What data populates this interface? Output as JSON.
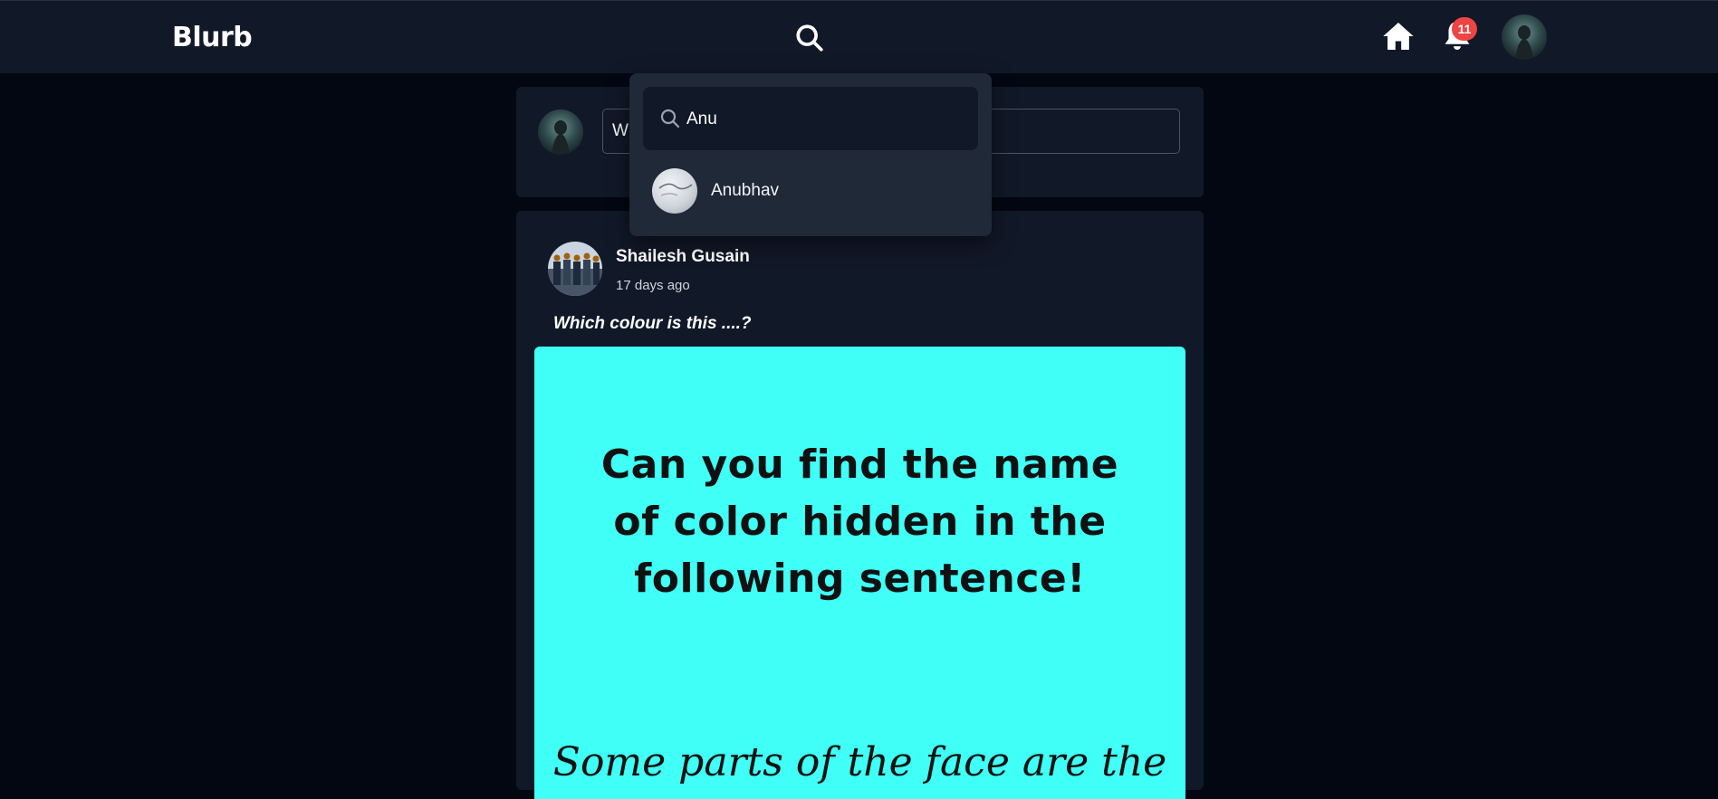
{
  "navbar": {
    "brand": "Blurb",
    "notification_count": "11",
    "icons": [
      "search-icon",
      "home-icon",
      "bell-icon"
    ]
  },
  "search": {
    "query": "Anu",
    "results": [
      {
        "name": "Anubhav"
      }
    ]
  },
  "composer": {
    "visible_text": "W"
  },
  "post": {
    "author": "Shailesh Gusain",
    "time": "17 days ago",
    "caption": "Which colour is this ....?",
    "image_text": {
      "line1": "Can you find the name",
      "line2": "of color hidden in the",
      "line3": "following sentence!",
      "line4": "Some parts of the face are the"
    },
    "image_bg": "#3ffff6"
  },
  "colors": {
    "navbar_bg": "#111827",
    "page_bg": "#030712",
    "card_bg": "#111827",
    "dropdown_bg": "#1f2937",
    "badge": "#ef4444"
  }
}
